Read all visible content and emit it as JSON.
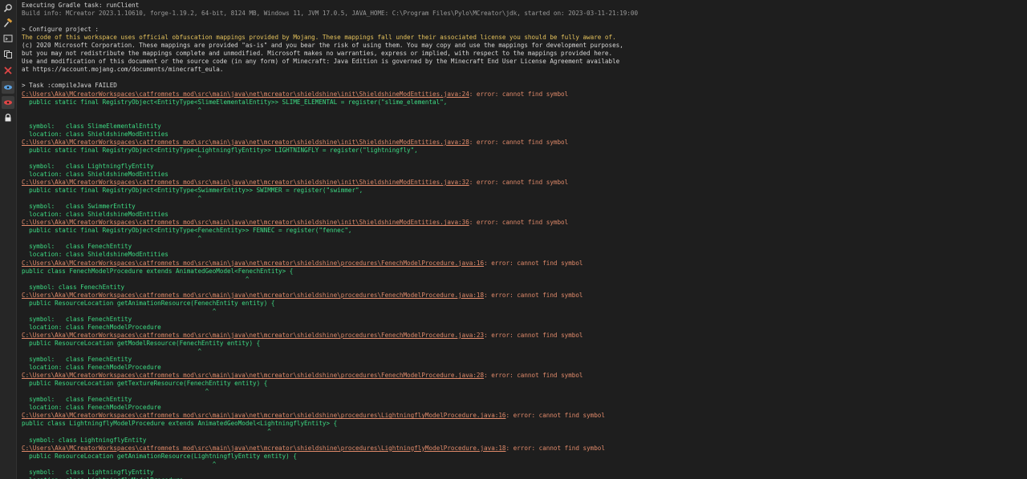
{
  "toolbar": {
    "buttons": [
      {
        "name": "search-icon"
      },
      {
        "name": "hammer-icon"
      },
      {
        "name": "terminal-icon"
      },
      {
        "name": "copy-icon"
      },
      {
        "name": "close-icon"
      },
      {
        "name": "eye-icon"
      },
      {
        "name": "eye-slash-icon"
      },
      {
        "name": "lock-icon"
      }
    ]
  },
  "console": {
    "lines": [
      {
        "segments": [
          {
            "text": "Executing Gradle task: runClient",
            "style": "plain"
          }
        ]
      },
      {
        "segments": [
          {
            "text": "Build info: MCreator 2023.1.10610, forge-1.19.2, 64-bit, 8124 MB, Windows 11, JVM 17.0.5, JAVA_HOME: C:\\Program Files\\Pylo\\MCreator\\jdk, started on: 2023-03-11-21:19:00",
            "style": "dim"
          }
        ]
      },
      {
        "segments": [
          {
            "text": "",
            "style": "plain"
          }
        ]
      },
      {
        "segments": [
          {
            "text": "> Configure project :",
            "style": "plain"
          }
        ]
      },
      {
        "segments": [
          {
            "text": "The code of this workspace uses official obfuscation mappings provided by Mojang. These mappings fall under their associated license you should be fully aware of.",
            "style": "warn"
          }
        ]
      },
      {
        "segments": [
          {
            "text": "(c) 2020 Microsoft Corporation. These mappings are provided \"as-is\" and you bear the risk of using them. You may copy and use the mappings for development purposes,",
            "style": "plain"
          }
        ]
      },
      {
        "segments": [
          {
            "text": "but you may not redistribute the mappings complete and unmodified. Microsoft makes no warranties, express or implied, with respect to the mappings provided here.",
            "style": "plain"
          }
        ]
      },
      {
        "segments": [
          {
            "text": "Use and modification of this document or the source code (in any form) of Minecraft: Java Edition is governed by the Minecraft End User License Agreement available",
            "style": "plain"
          }
        ]
      },
      {
        "segments": [
          {
            "text": "at https://account.mojang.com/documents/minecraft_eula.",
            "style": "plain"
          }
        ]
      },
      {
        "segments": [
          {
            "text": "",
            "style": "plain"
          }
        ]
      },
      {
        "segments": [
          {
            "text": "> Task :compileJava FAILED",
            "style": "plain"
          }
        ]
      },
      {
        "segments": [
          {
            "text": "C:\\Users\\Aka\\MCreatorWorkspaces\\catfromnets_mod\\src\\main\\java\\net\\mcreator\\shieldshine\\init\\ShieldshineModEntities.java:24",
            "style": "err-path"
          },
          {
            "text": ": error: cannot find symbol",
            "style": "err-msg"
          }
        ]
      },
      {
        "segments": [
          {
            "text": "  public static final RegistryObject<EntityType<SlimeElementalEntity>> SLIME_ELEMENTAL = register(\"slime_elemental\",",
            "style": "code"
          }
        ]
      },
      {
        "segments": [
          {
            "text": "                                                ^",
            "style": "code"
          }
        ]
      },
      {
        "segments": [
          {
            "text": "",
            "style": "plain"
          }
        ]
      },
      {
        "segments": [
          {
            "text": "  symbol:   class SlimeElementalEntity",
            "style": "code"
          }
        ]
      },
      {
        "segments": [
          {
            "text": "  location: class ShieldshineModEntities",
            "style": "code"
          }
        ]
      },
      {
        "segments": [
          {
            "text": "C:\\Users\\Aka\\MCreatorWorkspaces\\catfromnets_mod\\src\\main\\java\\net\\mcreator\\shieldshine\\init\\ShieldshineModEntities.java:28",
            "style": "err-path"
          },
          {
            "text": ": error: cannot find symbol",
            "style": "err-msg"
          }
        ]
      },
      {
        "segments": [
          {
            "text": "  public static final RegistryObject<EntityType<LightningflyEntity>> LIGHTNINGFLY = register(\"lightningfly\",",
            "style": "code"
          }
        ]
      },
      {
        "segments": [
          {
            "text": "                                                ^",
            "style": "code"
          }
        ]
      },
      {
        "segments": [
          {
            "text": "  symbol:   class LightningflyEntity",
            "style": "code"
          }
        ]
      },
      {
        "segments": [
          {
            "text": "  location: class ShieldshineModEntities",
            "style": "code"
          }
        ]
      },
      {
        "segments": [
          {
            "text": "C:\\Users\\Aka\\MCreatorWorkspaces\\catfromnets_mod\\src\\main\\java\\net\\mcreator\\shieldshine\\init\\ShieldshineModEntities.java:32",
            "style": "err-path"
          },
          {
            "text": ": error: cannot find symbol",
            "style": "err-msg"
          }
        ]
      },
      {
        "segments": [
          {
            "text": "  public static final RegistryObject<EntityType<SwimmerEntity>> SWIMMER = register(\"swimmer\",",
            "style": "code"
          }
        ]
      },
      {
        "segments": [
          {
            "text": "                                                ^",
            "style": "code"
          }
        ]
      },
      {
        "segments": [
          {
            "text": "  symbol:   class SwimmerEntity",
            "style": "code"
          }
        ]
      },
      {
        "segments": [
          {
            "text": "  location: class ShieldshineModEntities",
            "style": "code"
          }
        ]
      },
      {
        "segments": [
          {
            "text": "C:\\Users\\Aka\\MCreatorWorkspaces\\catfromnets_mod\\src\\main\\java\\net\\mcreator\\shieldshine\\init\\ShieldshineModEntities.java:36",
            "style": "err-path"
          },
          {
            "text": ": error: cannot find symbol",
            "style": "err-msg"
          }
        ]
      },
      {
        "segments": [
          {
            "text": "  public static final RegistryObject<EntityType<FenechEntity>> FENNEC = register(\"fennec\",",
            "style": "code"
          }
        ]
      },
      {
        "segments": [
          {
            "text": "                                                ^",
            "style": "code"
          }
        ]
      },
      {
        "segments": [
          {
            "text": "  symbol:   class FenechEntity",
            "style": "code"
          }
        ]
      },
      {
        "segments": [
          {
            "text": "  location: class ShieldshineModEntities",
            "style": "code"
          }
        ]
      },
      {
        "segments": [
          {
            "text": "C:\\Users\\Aka\\MCreatorWorkspaces\\catfromnets_mod\\src\\main\\java\\net\\mcreator\\shieldshine\\procedures\\FenechModelProcedure.java:16",
            "style": "err-path"
          },
          {
            "text": ": error: cannot find symbol",
            "style": "err-msg"
          }
        ]
      },
      {
        "segments": [
          {
            "text": "public class FenechModelProcedure extends AnimatedGeoModel<FenechEntity> {",
            "style": "code"
          }
        ]
      },
      {
        "segments": [
          {
            "text": "                                                             ^",
            "style": "code"
          }
        ]
      },
      {
        "segments": [
          {
            "text": "  symbol: class FenechEntity",
            "style": "code"
          }
        ]
      },
      {
        "segments": [
          {
            "text": "C:\\Users\\Aka\\MCreatorWorkspaces\\catfromnets_mod\\src\\main\\java\\net\\mcreator\\shieldshine\\procedures\\FenechModelProcedure.java:18",
            "style": "err-path"
          },
          {
            "text": ": error: cannot find symbol",
            "style": "err-msg"
          }
        ]
      },
      {
        "segments": [
          {
            "text": "  public ResourceLocation getAnimationResource(FenechEntity entity) {",
            "style": "code"
          }
        ]
      },
      {
        "segments": [
          {
            "text": "                                                    ^",
            "style": "code"
          }
        ]
      },
      {
        "segments": [
          {
            "text": "  symbol:   class FenechEntity",
            "style": "code"
          }
        ]
      },
      {
        "segments": [
          {
            "text": "  location: class FenechModelProcedure",
            "style": "code"
          }
        ]
      },
      {
        "segments": [
          {
            "text": "C:\\Users\\Aka\\MCreatorWorkspaces\\catfromnets_mod\\src\\main\\java\\net\\mcreator\\shieldshine\\procedures\\FenechModelProcedure.java:23",
            "style": "err-path"
          },
          {
            "text": ": error: cannot find symbol",
            "style": "err-msg"
          }
        ]
      },
      {
        "segments": [
          {
            "text": "  public ResourceLocation getModelResource(FenechEntity entity) {",
            "style": "code"
          }
        ]
      },
      {
        "segments": [
          {
            "text": "                                                ^",
            "style": "code"
          }
        ]
      },
      {
        "segments": [
          {
            "text": "  symbol:   class FenechEntity",
            "style": "code"
          }
        ]
      },
      {
        "segments": [
          {
            "text": "  location: class FenechModelProcedure",
            "style": "code"
          }
        ]
      },
      {
        "segments": [
          {
            "text": "C:\\Users\\Aka\\MCreatorWorkspaces\\catfromnets_mod\\src\\main\\java\\net\\mcreator\\shieldshine\\procedures\\FenechModelProcedure.java:28",
            "style": "err-path"
          },
          {
            "text": ": error: cannot find symbol",
            "style": "err-msg"
          }
        ]
      },
      {
        "segments": [
          {
            "text": "  public ResourceLocation getTextureResource(FenechEntity entity) {",
            "style": "code"
          }
        ]
      },
      {
        "segments": [
          {
            "text": "                                                  ^",
            "style": "code"
          }
        ]
      },
      {
        "segments": [
          {
            "text": "  symbol:   class FenechEntity",
            "style": "code"
          }
        ]
      },
      {
        "segments": [
          {
            "text": "  location: class FenechModelProcedure",
            "style": "code"
          }
        ]
      },
      {
        "segments": [
          {
            "text": "C:\\Users\\Aka\\MCreatorWorkspaces\\catfromnets_mod\\src\\main\\java\\net\\mcreator\\shieldshine\\procedures\\LightningflyModelProcedure.java:16",
            "style": "err-path"
          },
          {
            "text": ": error: cannot find symbol",
            "style": "err-msg"
          }
        ]
      },
      {
        "segments": [
          {
            "text": "public class LightningflyModelProcedure extends AnimatedGeoModel<LightningflyEntity> {",
            "style": "code"
          }
        ]
      },
      {
        "segments": [
          {
            "text": "                                                                   ^",
            "style": "code"
          }
        ]
      },
      {
        "segments": [
          {
            "text": "  symbol: class LightningflyEntity",
            "style": "code"
          }
        ]
      },
      {
        "segments": [
          {
            "text": "C:\\Users\\Aka\\MCreatorWorkspaces\\catfromnets_mod\\src\\main\\java\\net\\mcreator\\shieldshine\\procedures\\LightningflyModelProcedure.java:18",
            "style": "err-path"
          },
          {
            "text": ": error: cannot find symbol",
            "style": "err-msg"
          }
        ]
      },
      {
        "segments": [
          {
            "text": "  public ResourceLocation getAnimationResource(LightningflyEntity entity) {",
            "style": "code"
          }
        ]
      },
      {
        "segments": [
          {
            "text": "                                                    ^",
            "style": "code"
          }
        ]
      },
      {
        "segments": [
          {
            "text": "  symbol:   class LightningflyEntity",
            "style": "code"
          }
        ]
      },
      {
        "segments": [
          {
            "text": "  location: class LightningflyModelProcedure",
            "style": "code"
          }
        ]
      }
    ]
  }
}
